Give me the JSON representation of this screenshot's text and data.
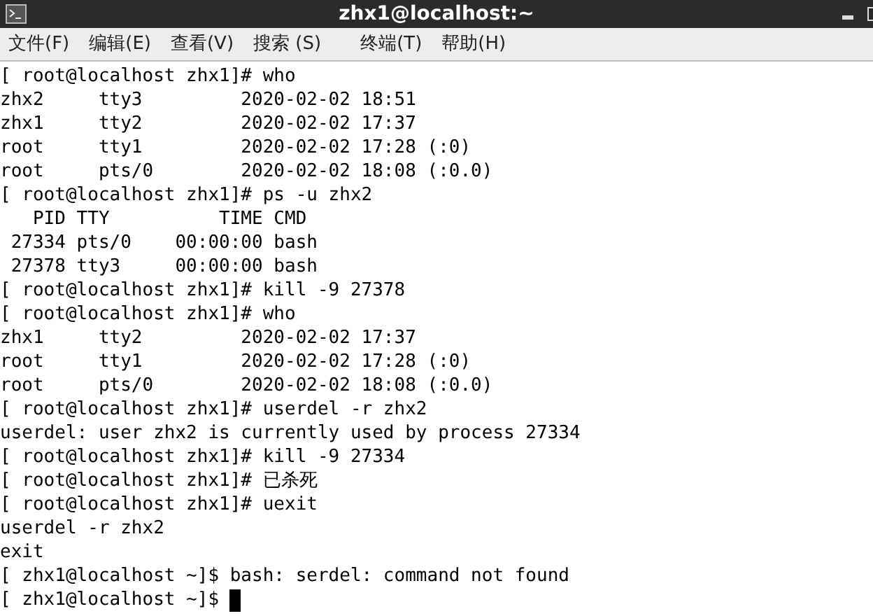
{
  "window": {
    "title": "zhx1@localhost:~"
  },
  "menu": [
    "文件(F)",
    "编辑(E)",
    "查看(V)",
    "搜索 (S)",
    "终端(T)",
    "帮助(H)"
  ],
  "terminal": {
    "lines": [
      "[ root@localhost zhx1]# who",
      "zhx2     tty3         2020-02-02 18:51",
      "zhx1     tty2         2020-02-02 17:37",
      "root     tty1         2020-02-02 17:28 (:0)",
      "root     pts/0        2020-02-02 18:08 (:0.0)",
      "[ root@localhost zhx1]# ps -u zhx2",
      "   PID TTY          TIME CMD",
      " 27334 pts/0    00:00:00 bash",
      " 27378 tty3     00:00:00 bash",
      "[ root@localhost zhx1]# kill -9 27378",
      "[ root@localhost zhx1]# who",
      "zhx1     tty2         2020-02-02 17:37",
      "root     tty1         2020-02-02 17:28 (:0)",
      "root     pts/0        2020-02-02 18:08 (:0.0)",
      "[ root@localhost zhx1]# userdel -r zhx2",
      "userdel: user zhx2 is currently used by process 27334",
      "[ root@localhost zhx1]# kill -9 27334",
      "[ root@localhost zhx1]# 已杀死",
      "[ root@localhost zhx1]# uexit",
      "userdel -r zhx2",
      "exit",
      "[ zhx1@localhost ~]$ bash: serdel: command not found",
      "[ zhx1@localhost ~]$ "
    ]
  }
}
